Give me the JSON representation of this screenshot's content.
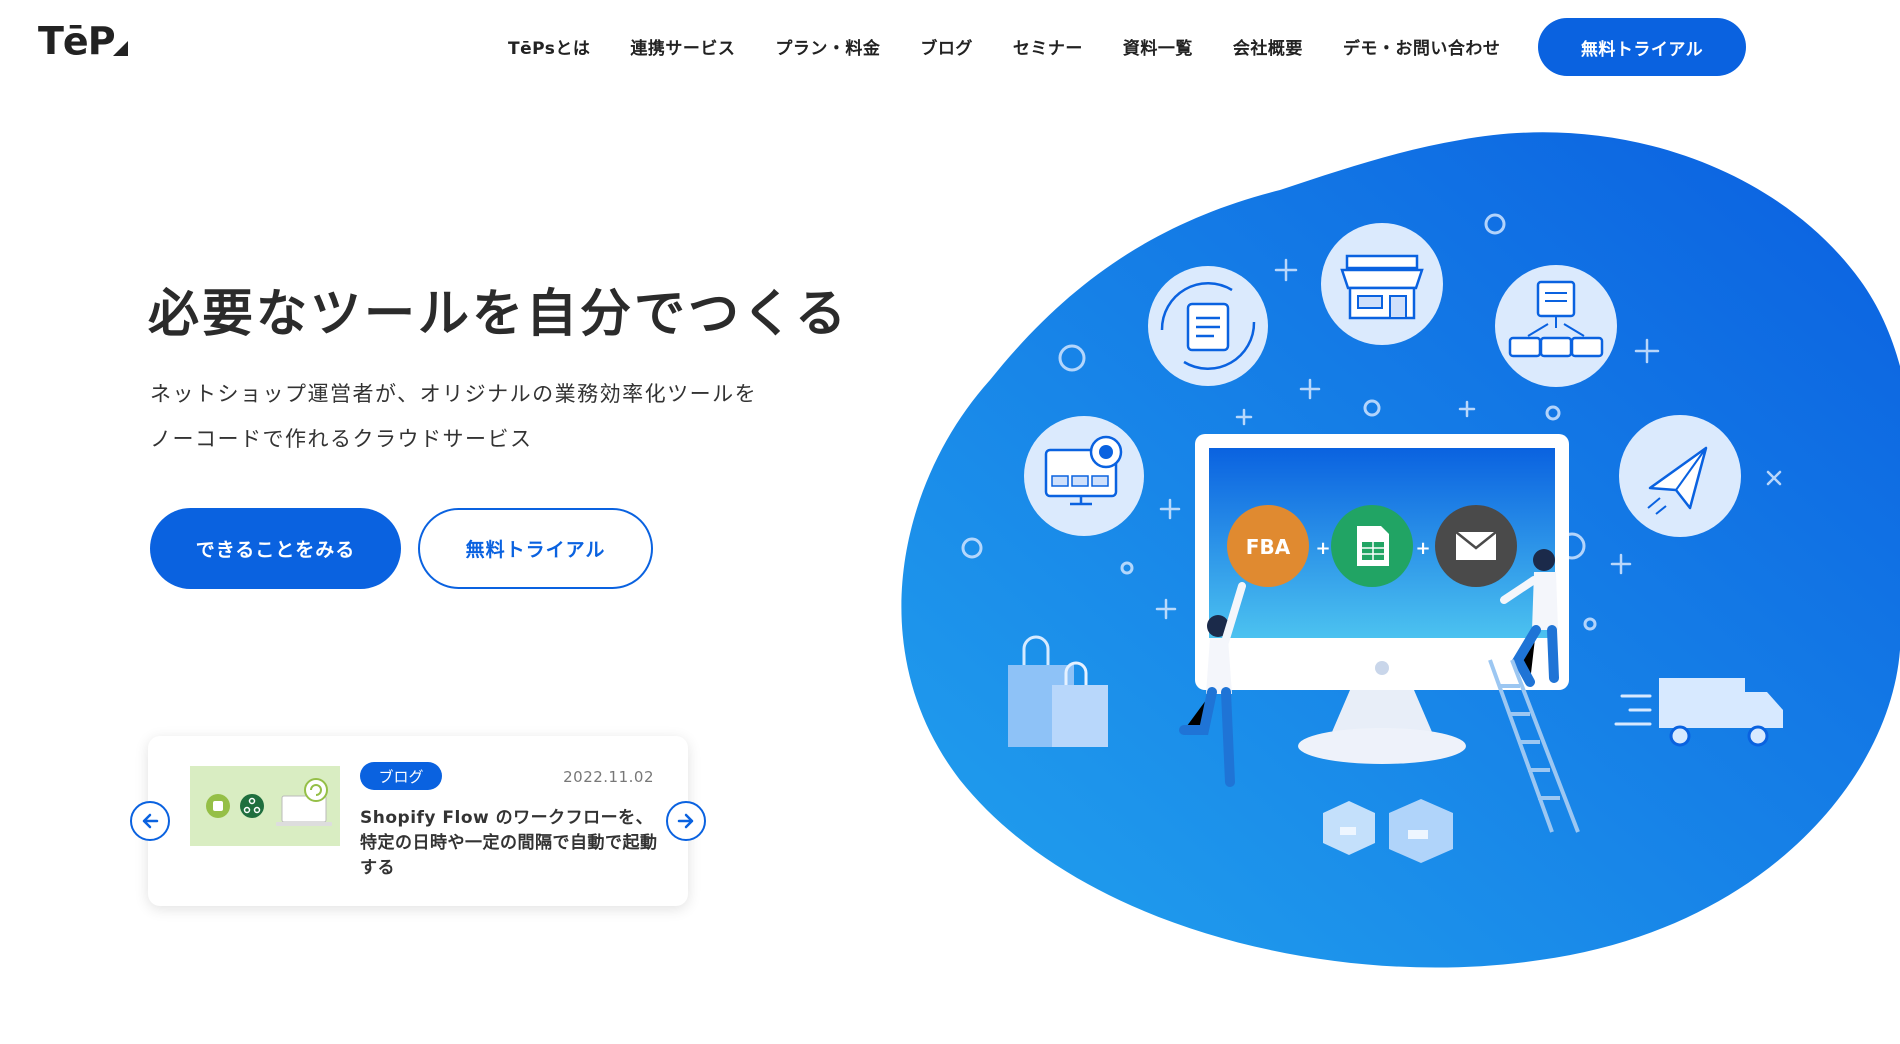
{
  "header": {
    "logo_text": "TēP",
    "nav": [
      {
        "label": "TēPsとは"
      },
      {
        "label": "連携サービス"
      },
      {
        "label": "プラン・料金"
      },
      {
        "label": "ブログ"
      },
      {
        "label": "セミナー"
      },
      {
        "label": "資料一覧"
      },
      {
        "label": "会社概要"
      },
      {
        "label": "デモ・お問い合わせ"
      }
    ],
    "cta_label": "無料トライアル"
  },
  "hero": {
    "title": "必要なツールを自分でつくる",
    "subtitle_line1": "ネットショップ運営者が、オリジナルの業務効率化ツールを",
    "subtitle_line2": "ノーコードで作れるクラウドサービス",
    "primary_button": "できることをみる",
    "secondary_button": "無料トライアル"
  },
  "blog_card": {
    "tag": "ブログ",
    "date": "2022.11.02",
    "title": "Shopify Flow のワークフローを、特定の日時や一定の間隔で自動で起動する"
  },
  "illustration": {
    "badges": [
      {
        "label": "FBA",
        "color": "#e08a30"
      },
      {
        "label": "sheets-icon",
        "color": "#21a464"
      },
      {
        "label": "mail-icon",
        "color": "#4a4a4a"
      }
    ],
    "colors": {
      "blob_start": "#1d8cf0",
      "blob_end": "#0a5fe0",
      "accent": "#0a62e0"
    }
  }
}
